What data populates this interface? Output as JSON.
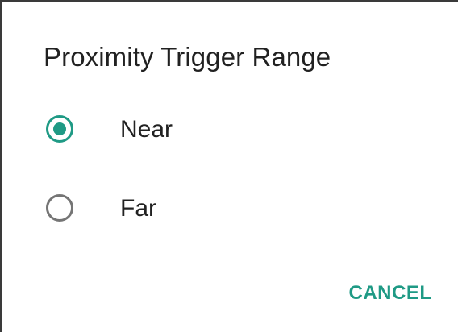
{
  "dialog": {
    "title": "Proximity Trigger Range",
    "options": [
      {
        "label": "Near",
        "selected": true
      },
      {
        "label": "Far",
        "selected": false
      }
    ],
    "cancel_label": "CANCEL"
  },
  "colors": {
    "accent": "#1f9a85",
    "text": "#212121",
    "radio_unchecked": "#757575"
  }
}
